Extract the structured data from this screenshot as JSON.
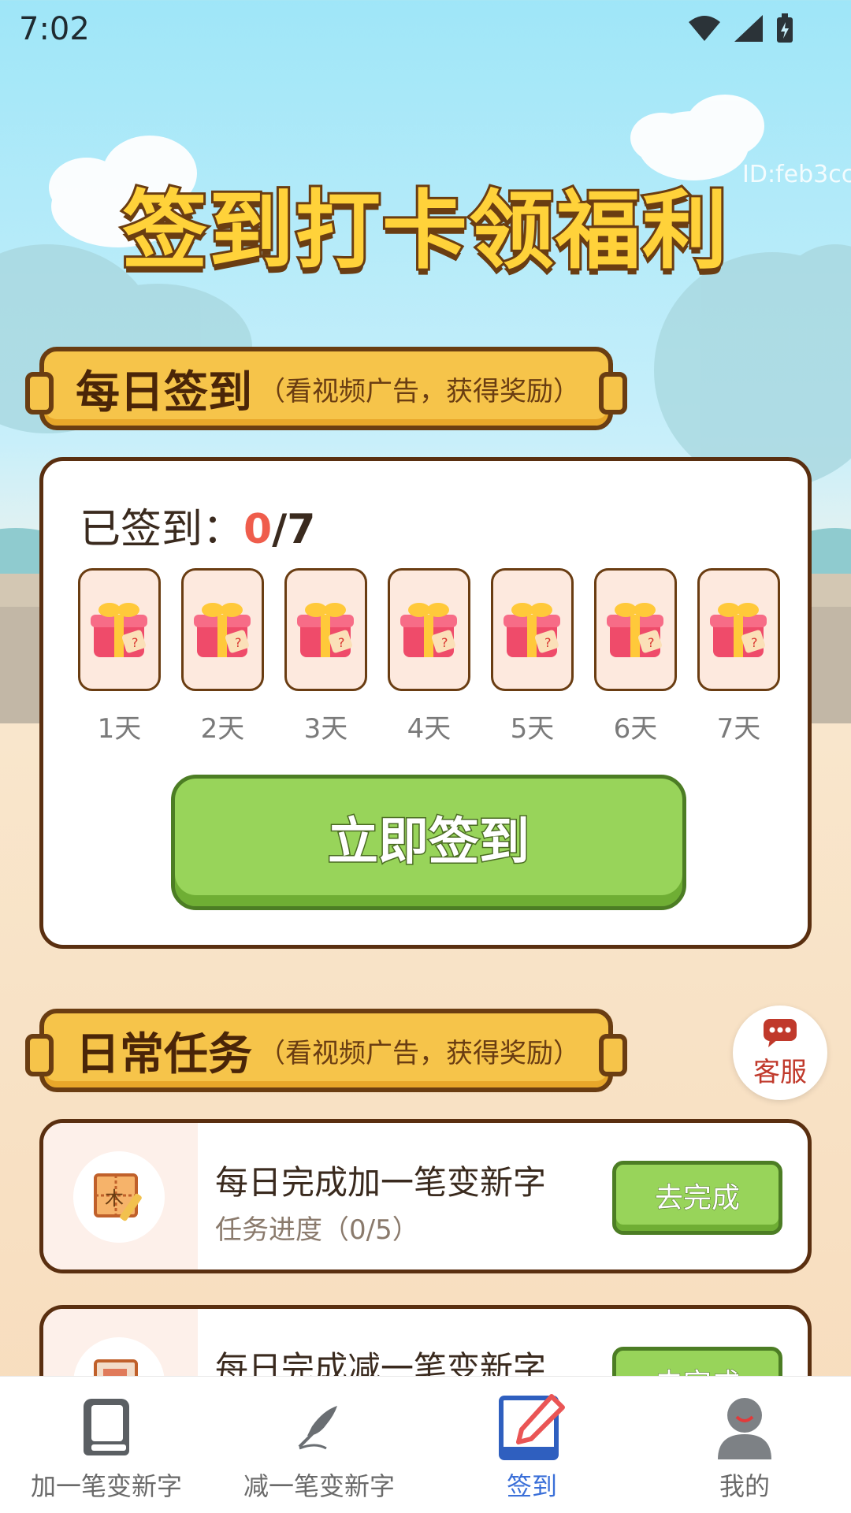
{
  "status_bar": {
    "time": "7:02"
  },
  "user_id": "ID:feb3cc",
  "hero": {
    "title": "签到打卡领福利"
  },
  "daily_checkin": {
    "section_title": "每日签到",
    "section_subtitle": "（看视频广告，获得奖励）",
    "signed_label": "已签到：",
    "signed_current": "0",
    "signed_total": "/7",
    "days": [
      "1天",
      "2天",
      "3天",
      "4天",
      "5天",
      "6天",
      "7天"
    ],
    "button_label": "立即签到"
  },
  "daily_tasks": {
    "section_title": "日常任务",
    "section_subtitle": "（看视频广告，获得奖励）",
    "items": [
      {
        "title": "每日完成加一笔变新字",
        "progress": "任务进度（0/5）",
        "button": "去完成"
      },
      {
        "title": "每日完成减一笔变新字",
        "progress": "",
        "button": "去完成"
      }
    ]
  },
  "service": {
    "label": "客服"
  },
  "bottom_nav": {
    "items": [
      {
        "label": "加一笔变新字",
        "icon": "book-icon"
      },
      {
        "label": "减一笔变新字",
        "icon": "feather-icon"
      },
      {
        "label": "签到",
        "icon": "checkin-pencil-icon",
        "active": true
      },
      {
        "label": "我的",
        "icon": "user-icon"
      }
    ]
  },
  "colors": {
    "accent_green": "#98d45a",
    "banner_yellow": "#f6c44a",
    "active_blue": "#3a6fd8",
    "count_red": "#ef5d4c"
  }
}
